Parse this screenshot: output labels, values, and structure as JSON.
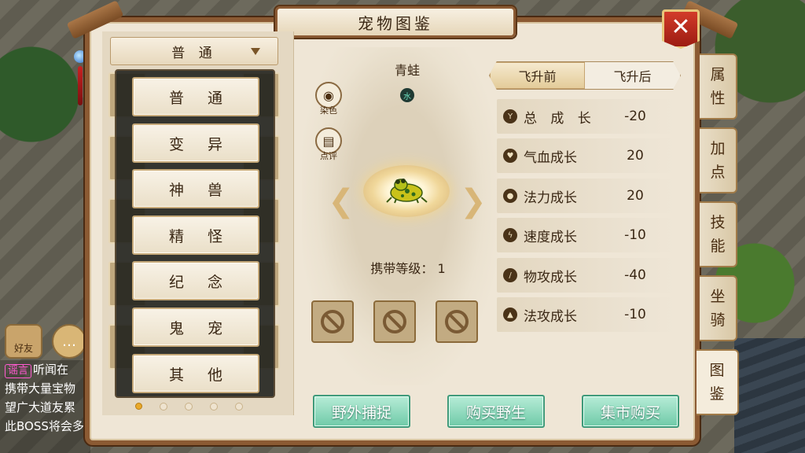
{
  "window": {
    "title": "宠物图鉴",
    "close_label": "✕"
  },
  "category_dropdown": {
    "selected": "普  通"
  },
  "category_menu": [
    "普 通",
    "变 异",
    "神 兽",
    "精 怪",
    "纪 念",
    "鬼 宠",
    "其 他"
  ],
  "pet": {
    "name": "青蛙",
    "element": "水",
    "carry_level_label": "携带等级：",
    "carry_level_value": "1"
  },
  "tools": {
    "dye_label": "染色",
    "review_label": "点评"
  },
  "ascension_tabs": {
    "before": "飞升前",
    "after": "飞升后",
    "active": "before"
  },
  "stats": [
    {
      "label": "总 成 长",
      "value": "-20",
      "icon": "growth-icon"
    },
    {
      "label": "气血成长",
      "value": "20",
      "icon": "heart-icon"
    },
    {
      "label": "法力成长",
      "value": "20",
      "icon": "mana-drop-icon"
    },
    {
      "label": "速度成长",
      "value": "-10",
      "icon": "lightning-icon"
    },
    {
      "label": "物攻成长",
      "value": "-40",
      "icon": "sword-icon"
    },
    {
      "label": "法攻成长",
      "value": "-10",
      "icon": "flame-icon"
    }
  ],
  "actions": {
    "wild_capture": "野外捕捉",
    "buy_wild": "购买野生",
    "market_buy": "集市购买"
  },
  "side_tabs": [
    {
      "line1": "属",
      "line2": "性"
    },
    {
      "line1": "加",
      "line2": "点"
    },
    {
      "line1": "技",
      "line2": "能"
    },
    {
      "line1": "坐",
      "line2": "骑"
    },
    {
      "line1": "图",
      "line2": "鉴"
    }
  ],
  "active_side_tab": "图鉴",
  "chat": {
    "friend_label": "好友",
    "rumor_tag": "谣言",
    "lines": [
      "听闻在",
      "携带大量宝物",
      "望广大道友累",
      "此BOSS将会多"
    ]
  },
  "pager": {
    "total_pages": 5,
    "current_page": 1
  },
  "colors": {
    "primary_button": "#6fcaa8",
    "close_button": "#c42b1e",
    "panel_bg": "#efe6d6",
    "menu_overlay": "#1c1e1a"
  }
}
